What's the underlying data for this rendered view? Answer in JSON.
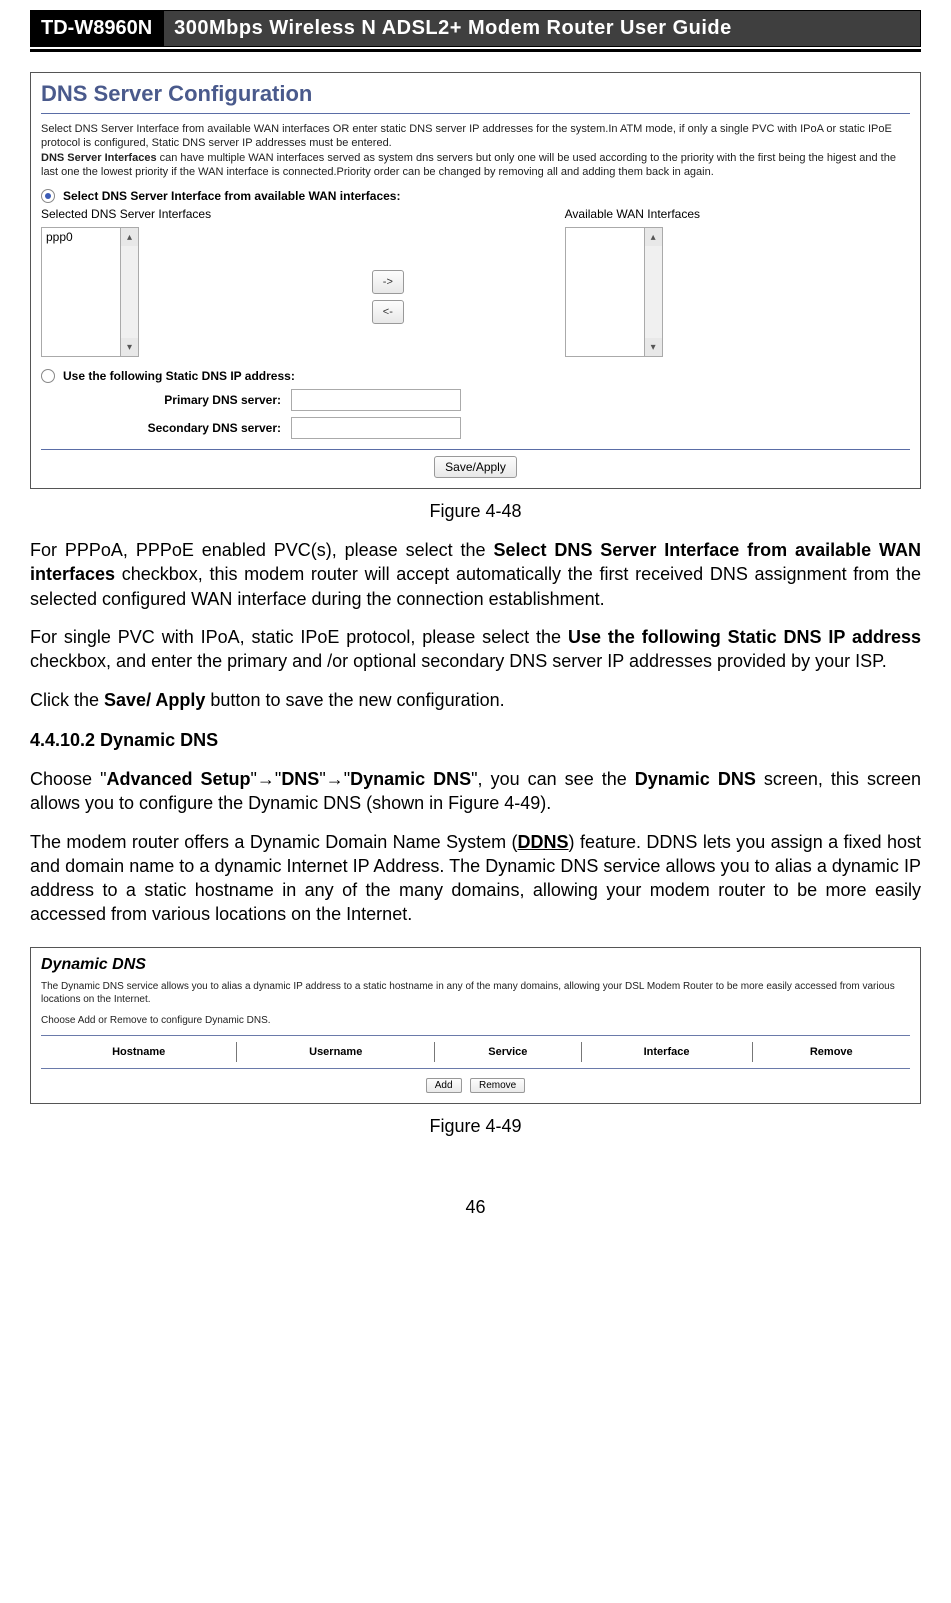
{
  "header": {
    "model": "TD-W8960N",
    "title": "300Mbps Wireless N ADSL2+ Modem Router User Guide"
  },
  "figure1": {
    "title": "DNS Server Configuration",
    "desc_line1": "Select DNS Server Interface from available WAN interfaces OR enter static DNS server IP addresses for the system.In ATM mode, if only a single PVC with IPoA or static IPoE protocol is configured, Static DNS server IP addresses must be entered.",
    "desc_line2_prefix": "DNS Server Interfaces",
    "desc_line2_rest": " can have multiple WAN interfaces served as system dns servers but only one will be used according to the priority with the first being the higest and the last one the lowest priority if the WAN interface is connected.Priority order can be changed by removing all and adding them back in again.",
    "radio1_label": "Select DNS Server Interface from available WAN interfaces:",
    "selected_header": "Selected DNS Server Interfaces",
    "available_header": "Available WAN Interfaces",
    "selected_items": [
      "ppp0"
    ],
    "move_right": "->",
    "move_left": "<-",
    "radio2_label": "Use the following Static DNS IP address:",
    "primary_label": "Primary DNS server:",
    "secondary_label": "Secondary DNS server:",
    "save_apply": "Save/Apply",
    "caption": "Figure 4-48"
  },
  "paragraphs": {
    "p1_a": "For PPPoA, PPPoE enabled PVC(s), please select the ",
    "p1_b": "Select DNS Server Interface from available WAN interfaces",
    "p1_c": " checkbox, this modem router will accept automatically the first received DNS assignment from the selected configured WAN interface during the connection establishment.",
    "p2_a": "For single PVC with IPoA, static IPoE protocol, please select the ",
    "p2_b": "Use the following Static DNS IP address",
    "p2_c": " checkbox, and enter the primary and /or optional secondary DNS server IP addresses provided by your ISP.",
    "p3_a": "Click the ",
    "p3_b": "Save/ Apply",
    "p3_c": " button to save the new configuration.",
    "heading": "4.4.10.2 Dynamic DNS",
    "p4_a": "Choose \"",
    "p4_b": "Advanced Setup",
    "p4_c": "\"",
    "arrow": "→",
    "p4_d": "\"",
    "p4_e": "DNS",
    "p4_f": "\"",
    "p4_g": "\"",
    "p4_h": "Dynamic DNS",
    "p4_i": "\", you can see the ",
    "p4_j": "Dynamic DNS",
    "p4_k": " screen, this screen allows you to configure the Dynamic DNS (shown in Figure 4-49).",
    "p5_a": "The modem router offers a Dynamic Domain Name System (",
    "p5_b": "DDNS",
    "p5_c": ") feature. DDNS lets you assign a fixed host and domain name to a dynamic Internet IP Address. The Dynamic DNS service allows you to alias a dynamic IP address to a static hostname in any of the many domains, allowing your modem router to be more easily accessed from various locations on the Internet."
  },
  "figure2": {
    "title": "Dynamic DNS",
    "desc": "The Dynamic DNS service allows you to alias a dynamic IP address to a static hostname in any of the many domains, allowing your DSL Modem Router to be more easily accessed from various locations on the Internet.",
    "choose": "Choose Add or Remove to configure Dynamic DNS.",
    "cols": [
      "Hostname",
      "Username",
      "Service",
      "Interface",
      "Remove"
    ],
    "add": "Add",
    "remove": "Remove",
    "caption": "Figure 4-49"
  },
  "page_number": "46"
}
